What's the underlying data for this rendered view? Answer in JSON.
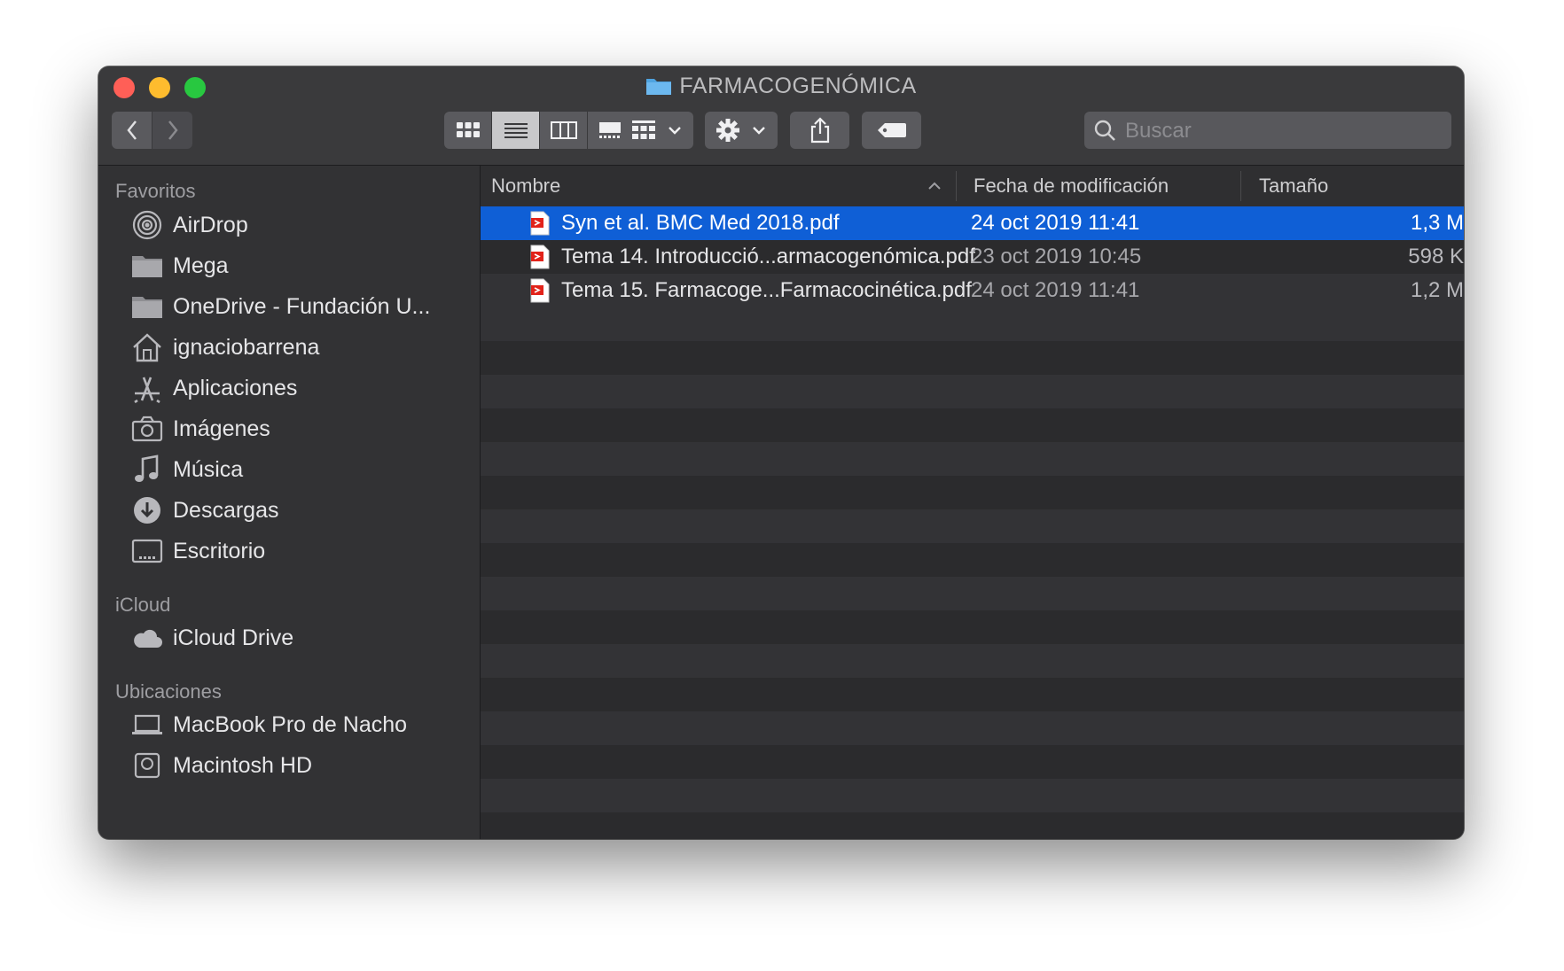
{
  "window": {
    "title": "FARMACOGENÓMICA"
  },
  "toolbar": {
    "search_placeholder": "Buscar"
  },
  "sidebar": {
    "sections": [
      {
        "title": "Favoritos"
      },
      {
        "title": "iCloud"
      },
      {
        "title": "Ubicaciones"
      }
    ],
    "favorites": [
      {
        "label": "AirDrop"
      },
      {
        "label": "Mega"
      },
      {
        "label": "OneDrive - Fundación U..."
      },
      {
        "label": "ignaciobarrena"
      },
      {
        "label": "Aplicaciones"
      },
      {
        "label": "Imágenes"
      },
      {
        "label": "Música"
      },
      {
        "label": "Descargas"
      },
      {
        "label": "Escritorio"
      }
    ],
    "icloud": [
      {
        "label": "iCloud Drive"
      }
    ],
    "locations": [
      {
        "label": "MacBook Pro de Nacho"
      },
      {
        "label": "Macintosh HD"
      }
    ]
  },
  "list": {
    "columns": {
      "name": "Nombre",
      "date": "Fecha de modificación",
      "size": "Tamaño"
    },
    "files": [
      {
        "name": "Syn et al.  BMC Med 2018.pdf",
        "date": "24 oct 2019 11:41",
        "size": "1,3 M",
        "selected": true
      },
      {
        "name": "Tema 14. Introducció...armacogenómica.pdf",
        "date": "23 oct 2019 10:45",
        "size": "598 K",
        "selected": false
      },
      {
        "name": "Tema 15. Farmacoge...Farmacocinética.pdf",
        "date": "24 oct 2019 11:41",
        "size": "1,2 M",
        "selected": false
      }
    ]
  },
  "colors": {
    "selection": "#0f5fd6",
    "folder": "#4fa3e0",
    "pdf": "#e2231a"
  }
}
